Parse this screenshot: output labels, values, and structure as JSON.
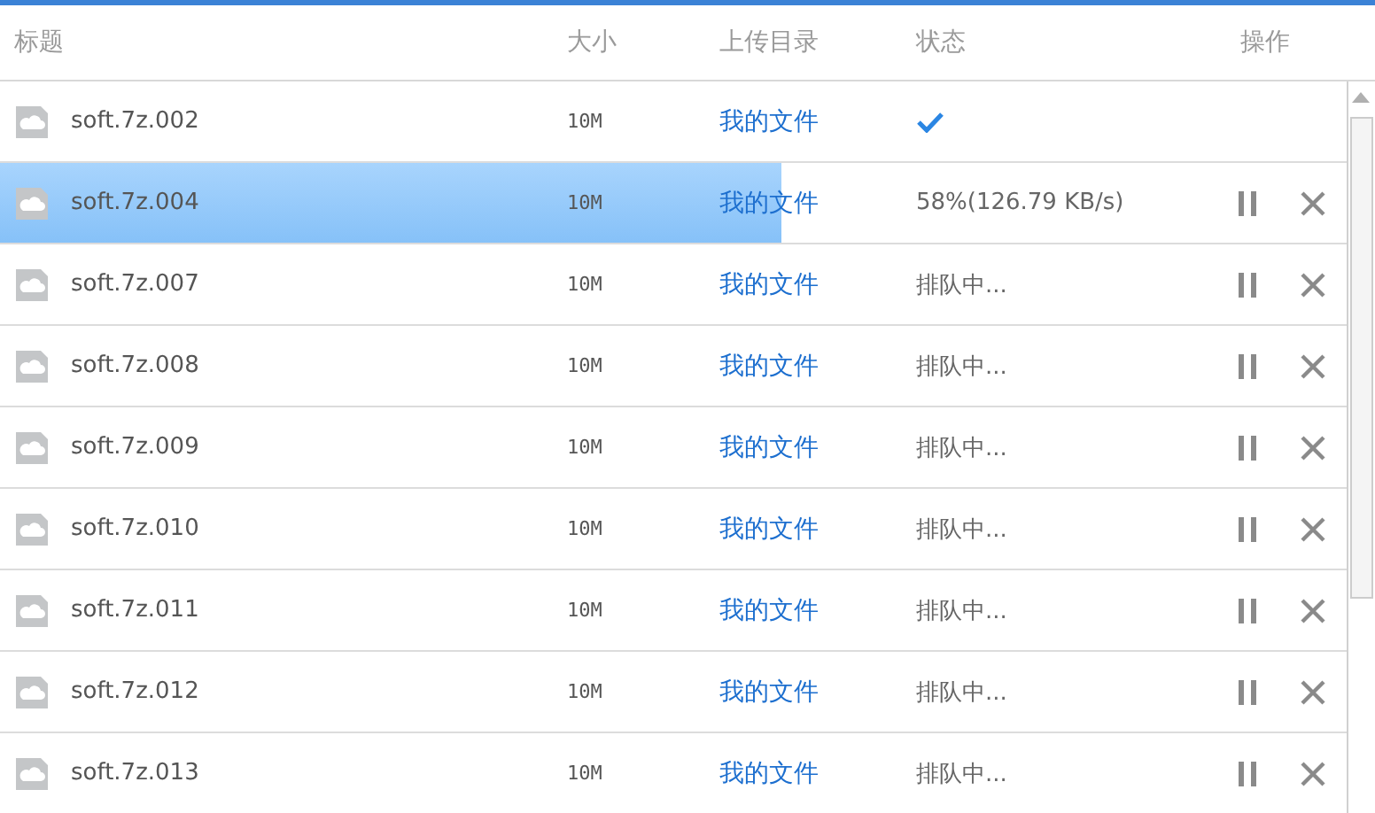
{
  "table": {
    "columns": [
      "标题",
      "大小",
      "上传目录",
      "状态",
      "操作"
    ],
    "rows": [
      {
        "kind": "done",
        "title": "soft.7z.002",
        "size": "10M",
        "folder": "我的文件"
      },
      {
        "kind": "uploading",
        "title": "soft.7z.004",
        "size": "10M",
        "folder": "我的文件",
        "status": "58%(126.79 KB/s)",
        "level": 0.58
      },
      {
        "kind": "queued",
        "title": "soft.7z.007",
        "size": "10M",
        "folder": "我的文件",
        "status": "排队中..."
      },
      {
        "kind": "queued",
        "title": "soft.7z.008",
        "size": "10M",
        "folder": "我的文件",
        "status": "排队中..."
      },
      {
        "kind": "queued",
        "title": "soft.7z.009",
        "size": "10M",
        "folder": "我的文件",
        "status": "排队中..."
      },
      {
        "kind": "queued",
        "title": "soft.7z.010",
        "size": "10M",
        "folder": "我的文件",
        "status": "排队中..."
      },
      {
        "kind": "queued",
        "title": "soft.7z.011",
        "size": "10M",
        "folder": "我的文件",
        "status": "排队中..."
      },
      {
        "kind": "queued",
        "title": "soft.7z.012",
        "size": "10M",
        "folder": "我的文件",
        "status": "排队中..."
      },
      {
        "kind": "queued",
        "title": "soft.7z.013",
        "size": "10M",
        "folder": "我的文件",
        "status": "排队中..."
      }
    ]
  }
}
